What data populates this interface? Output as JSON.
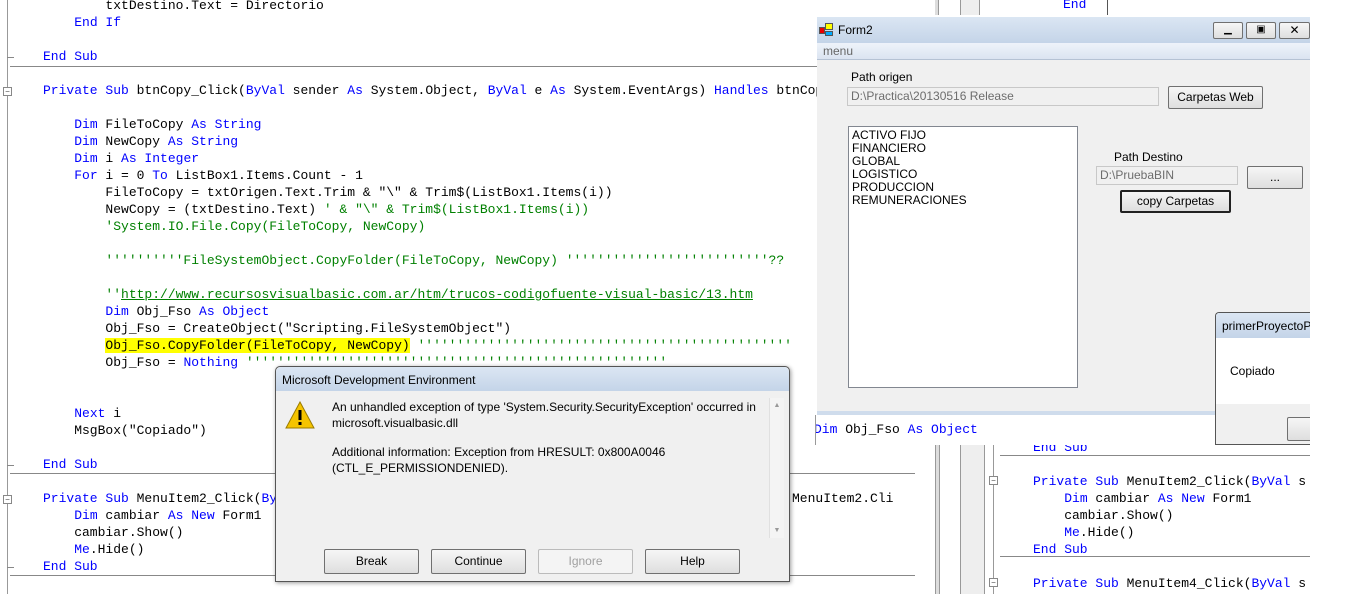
{
  "editor_main": {
    "lines": [
      [
        [
          "        txtDestino.Text = Directorio",
          "tx"
        ]
      ],
      [
        [
          "    ",
          "tx"
        ],
        [
          "End If",
          "kw"
        ]
      ],
      [],
      [
        [
          "End Sub",
          "kw"
        ]
      ],
      [],
      [
        [
          "Private Sub",
          "kw"
        ],
        [
          " btnCopy_Click(",
          "tx"
        ],
        [
          "ByVal",
          "kw"
        ],
        [
          " sender ",
          "tx"
        ],
        [
          "As",
          "kw"
        ],
        [
          " System.Object, ",
          "tx"
        ],
        [
          "ByVal",
          "kw"
        ],
        [
          " e ",
          "tx"
        ],
        [
          "As",
          "kw"
        ],
        [
          " System.EventArgs) ",
          "tx"
        ],
        [
          "Handles",
          "kw"
        ],
        [
          " btnCopy.Click",
          "tx"
        ]
      ],
      [],
      [
        [
          "    ",
          "tx"
        ],
        [
          "Dim",
          "kw"
        ],
        [
          " FileToCopy ",
          "tx"
        ],
        [
          "As String",
          "kw"
        ]
      ],
      [
        [
          "    ",
          "tx"
        ],
        [
          "Dim",
          "kw"
        ],
        [
          " NewCopy ",
          "tx"
        ],
        [
          "As String",
          "kw"
        ]
      ],
      [
        [
          "    ",
          "tx"
        ],
        [
          "Dim",
          "kw"
        ],
        [
          " i ",
          "tx"
        ],
        [
          "As Integer",
          "kw"
        ]
      ],
      [
        [
          "    ",
          "tx"
        ],
        [
          "For",
          "kw"
        ],
        [
          " i = 0 ",
          "tx"
        ],
        [
          "To",
          "kw"
        ],
        [
          " ListBox1.Items.Count - 1",
          "tx"
        ]
      ],
      [
        [
          "        FileToCopy = txtOrigen.Text.Trim & \"\\\" & Trim$(ListBox1.Items(i))",
          "tx"
        ]
      ],
      [
        [
          "        NewCopy = (txtDestino.Text) ",
          "tx"
        ],
        [
          "' & \"\\\" & Trim$(ListBox1.Items(i))",
          "cm"
        ]
      ],
      [
        [
          "        ",
          "tx"
        ],
        [
          "'System.IO.File.Copy(FileToCopy, NewCopy)",
          "cm"
        ]
      ],
      [],
      [
        [
          "        ",
          "tx"
        ],
        [
          "''''''''''FileSystemObject.CopyFolder(FileToCopy, NewCopy) ''''''''''''''''''''''''''??",
          "cm"
        ]
      ],
      [],
      [
        [
          "        ",
          "tx"
        ],
        [
          "''",
          "cm"
        ],
        [
          "http://www.recursosvisualbasic.com.ar/htm/trucos-codigofuente-visual-basic/13.htm",
          "ln"
        ]
      ],
      [
        [
          "        ",
          "tx"
        ],
        [
          "Dim",
          "kw"
        ],
        [
          " Obj_Fso ",
          "tx"
        ],
        [
          "As Object",
          "kw"
        ]
      ],
      [
        [
          "        Obj_Fso = CreateObject(\"Scripting.FileSystemObject\")",
          "tx"
        ]
      ],
      [
        [
          "        ",
          "tx"
        ],
        [
          "Obj_Fso.CopyFolder(FileToCopy, NewCopy)",
          "hl"
        ],
        [
          " ''''''''''''''''''''''''''''''''''''''''''''''''",
          "cm"
        ]
      ],
      [
        [
          "        Obj_Fso = ",
          "tx"
        ],
        [
          "Nothing",
          "kw"
        ],
        [
          " ''''''''''''''''''''''''''''''''''''''''''''''''''''''",
          "cm"
        ]
      ],
      [],
      [],
      [
        [
          "    ",
          "tx"
        ],
        [
          "Next",
          "kw"
        ],
        [
          " i",
          "tx"
        ]
      ],
      [
        [
          "    MsgBox(\"Copiado\")",
          "tx"
        ]
      ],
      [],
      [
        [
          "End Sub",
          "kw"
        ]
      ],
      [],
      [
        [
          "Private Sub",
          "kw"
        ],
        [
          " MenuItem2_Click(",
          "tx"
        ],
        [
          "ByVal",
          "kw"
        ],
        [
          " sender ",
          "tx"
        ],
        [
          "As",
          "kw"
        ],
        [
          " System.Object, ",
          "tx"
        ],
        [
          "ByVal",
          "kw"
        ],
        [
          " e ",
          "tx"
        ],
        [
          "As",
          "kw"
        ],
        [
          " System.EventArgs) ",
          "tx"
        ],
        [
          "Handles",
          "kw"
        ],
        [
          " MenuItem2.Cli",
          "tx"
        ]
      ],
      [
        [
          "    ",
          "tx"
        ],
        [
          "Dim",
          "kw"
        ],
        [
          " cambiar ",
          "tx"
        ],
        [
          "As New",
          "kw"
        ],
        [
          " Form1",
          "tx"
        ]
      ],
      [
        [
          "    cambiar.Show()",
          "tx"
        ]
      ],
      [
        [
          "    ",
          "tx"
        ],
        [
          "Me",
          "kw"
        ],
        [
          ".Hide()",
          "tx"
        ]
      ],
      [
        [
          "End Sub",
          "kw"
        ]
      ]
    ]
  },
  "editor_fragment": {
    "line": [
      [
        "Dim",
        "kw"
      ],
      [
        " Obj_Fso ",
        "tx"
      ],
      [
        "As Object",
        "kw"
      ]
    ],
    "top_word": "End"
  },
  "editor_right": {
    "lines": [
      [
        [
          "End Sub",
          "kw"
        ]
      ],
      [],
      [
        [
          "Private Sub",
          "kw"
        ],
        [
          " MenuItem2_Click(",
          "tx"
        ],
        [
          "ByVal",
          "kw"
        ],
        [
          " s",
          "tx"
        ]
      ],
      [
        [
          "    ",
          "tx"
        ],
        [
          "Dim",
          "kw"
        ],
        [
          " cambiar ",
          "tx"
        ],
        [
          "As New",
          "kw"
        ],
        [
          " Form1",
          "tx"
        ]
      ],
      [
        [
          "    cambiar.Show()",
          "tx"
        ]
      ],
      [
        [
          "    ",
          "tx"
        ],
        [
          "Me",
          "kw"
        ],
        [
          ".Hide()",
          "tx"
        ]
      ],
      [
        [
          "End Sub",
          "kw"
        ]
      ],
      [],
      [
        [
          "Private Sub",
          "kw"
        ],
        [
          " MenuItem4_Click(",
          "tx"
        ],
        [
          "ByVal",
          "kw"
        ],
        [
          " s",
          "tx"
        ]
      ]
    ]
  },
  "form2": {
    "title": "Form2",
    "menu": "menu",
    "path_origen_label": "Path origen",
    "path_origen_value": "D:\\Practica\\20130516 Release",
    "carpetas_web": "Carpetas Web",
    "list_items": [
      "ACTIVO FIJO",
      "FINANCIERO",
      "GLOBAL",
      "LOGISTICO",
      "PRODUCCION",
      "REMUNERACIONES"
    ],
    "path_destino_label": "Path Destino",
    "path_destino_value": "D:\\PruebaBIN",
    "browse": "...",
    "copy": "copy Carpetas"
  },
  "msgbox": {
    "title": "primerProyectoP",
    "text": "Copiado"
  },
  "dialog": {
    "title": "Microsoft Development Environment",
    "message1": "An unhandled exception of type 'System.Security.SecurityException' occurred in microsoft.visualbasic.dll",
    "message2": "Additional information: Exception from HRESULT: 0x800A0046 (CTL_E_PERMISSIONDENIED).",
    "buttons": {
      "break": "Break",
      "continue": "Continue",
      "ignore": "Ignore",
      "help": "Help"
    },
    "icon": "warning-icon"
  },
  "colors": {
    "keyword": "#0000ff",
    "comment": "#008000",
    "highlight": "#ffff00"
  }
}
